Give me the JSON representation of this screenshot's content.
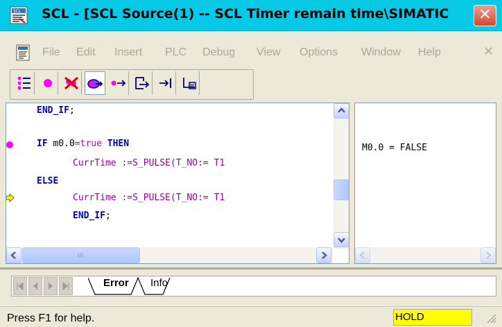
{
  "window": {
    "title": "SCL  - [SCL Source(1) -- SCL Timer remain time\\SIMATIC",
    "close_glyph": "✕"
  },
  "menu": {
    "items": [
      "File",
      "Edit",
      "Insert",
      "PLC",
      "Debug",
      "View",
      "Options",
      "Window",
      "Help"
    ],
    "close_glyph": "✕"
  },
  "toolbar": {
    "buttons": [
      "breakpoints-list-icon",
      "set-breakpoint-icon",
      "delete-breakpoints-icon",
      "monitor-icon",
      "step-over-icon",
      "step-into-icon",
      "step-out-icon",
      "run-to-cursor-icon"
    ]
  },
  "editor": {
    "lines": [
      {
        "kw1": "END_IF",
        "rest": ";"
      },
      {
        "kw1": "IF",
        "id": " m0.0",
        "op": "=",
        "val": "true",
        "kw2": " THEN"
      },
      {
        "text": "CurrTime :=S_PULSE(T_NO:= T1"
      },
      {
        "kw1": "ELSE"
      },
      {
        "text": "CurrTime :=S_PULSE(T_NO:= T1"
      },
      {
        "kw1": "END_IF",
        "rest": ";"
      }
    ]
  },
  "watch": {
    "value_line": "M0.0 = FALSE"
  },
  "output": {
    "tabs": [
      "Error",
      "Info"
    ]
  },
  "status": {
    "help_text": "Press F1 for help.",
    "mode": "HOLD"
  },
  "colors": {
    "title_bg": "#06c9e6",
    "keyword": "#0000c0",
    "function": "#9b009b",
    "breakpoint": "#ff00ff",
    "hold_bg": "#ffff00"
  }
}
